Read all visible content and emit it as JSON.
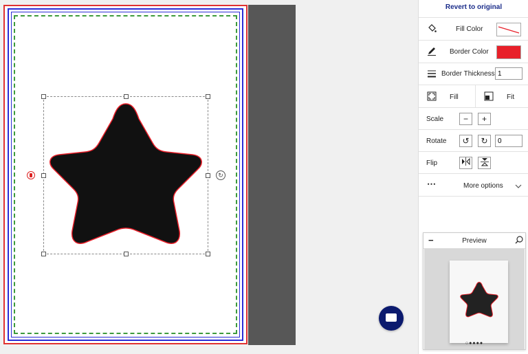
{
  "panel": {
    "revert_label": "Revert to original",
    "fill_color": {
      "label": "Fill Color",
      "icon": "paint-bucket-icon"
    },
    "border_color": {
      "label": "Border Color",
      "icon": "pencil-icon",
      "value": "#e8202a"
    },
    "border_thickness": {
      "label": "Border Thickness",
      "icon": "lines-icon",
      "value": "1"
    },
    "fill_label": "Fill",
    "fit_label": "Fit",
    "scale_label": "Scale",
    "scale_minus": "−",
    "scale_plus": "+",
    "rotate_label": "Rotate",
    "rotate_value": "0",
    "flip_label": "Flip",
    "more_options_label": "More options"
  },
  "preview": {
    "title": "Preview",
    "minimize_symbol": "−",
    "dots": "○●●●●"
  },
  "colors": {
    "page_border": "#e03030",
    "bleed_line": "#2b2bd6",
    "safe_line": "#3c9a3c",
    "star_fill": "#111111",
    "star_stroke": "#e8202a",
    "accent": "#0b1a6e"
  }
}
